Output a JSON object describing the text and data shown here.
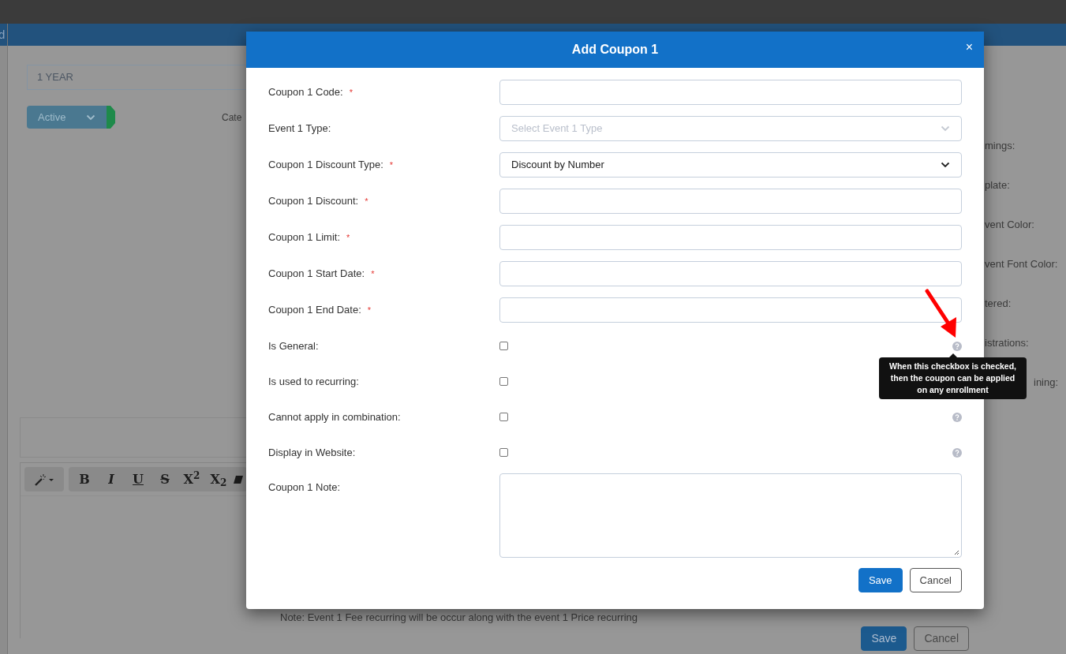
{
  "background": {
    "edge_text": "d",
    "duration_value": "1 YEAR",
    "status_select": "Active",
    "category_label": "Cate",
    "side_labels": [
      {
        "text": "mings:",
        "kind": "cut"
      },
      {
        "text": "plate:",
        "kind": "cut"
      },
      {
        "text": "vent Color:",
        "kind": "cut"
      },
      {
        "text": "vent Font Color:",
        "kind": "cut"
      },
      {
        "text": "tered:",
        "kind": "cut"
      },
      {
        "text": "istrations:",
        "kind": "cut"
      },
      {
        "text": "ining:",
        "kind": "covered"
      }
    ],
    "toolbar": [
      {
        "kind": "bold",
        "label": "B"
      },
      {
        "kind": "italic",
        "label": "I"
      },
      {
        "kind": "underline",
        "label": "U"
      },
      {
        "kind": "strike",
        "label": "S"
      },
      {
        "kind": "superscript",
        "label": "X$^{2}$"
      },
      {
        "kind": "subscript",
        "label": "X$_{2}$"
      }
    ],
    "note": "Note: Event 1 Fee recurring will be occur along with the event 1 Price recurring",
    "buttons": [
      {
        "kind": "primary",
        "label": "Save"
      },
      {
        "kind": "secondary",
        "label": "Cancel"
      }
    ]
  },
  "modal": {
    "title": "Add Coupon 1",
    "close": "×",
    "required_mark": "*",
    "fields": [
      {
        "kind": "text",
        "label": "Coupon 1 Code:",
        "required": true
      },
      {
        "kind": "select",
        "label": "Event 1 Type:",
        "required": false,
        "placeholder": "Select Event 1 Type"
      },
      {
        "kind": "select",
        "label": "Coupon 1 Discount Type:",
        "required": true,
        "value": "Discount by Number"
      },
      {
        "kind": "text",
        "label": "Coupon 1 Discount:",
        "required": true
      },
      {
        "kind": "text",
        "label": "Coupon 1 Limit:",
        "required": true
      },
      {
        "kind": "text",
        "label": "Coupon 1 Start Date:",
        "required": true
      },
      {
        "kind": "text",
        "label": "Coupon 1 End Date:",
        "required": true
      },
      {
        "kind": "checkbox",
        "label": "Is General:",
        "checked": false,
        "help": true,
        "tooltip": "When this checkbox is checked, then the coupon can be applied on any enrollment"
      },
      {
        "kind": "checkbox",
        "label": "Is used to recurring:",
        "checked": false
      },
      {
        "kind": "checkbox",
        "label": "Cannot apply in combination:",
        "checked": false,
        "help": true
      },
      {
        "kind": "checkbox",
        "label": "Display in Website:",
        "checked": false,
        "help": true
      },
      {
        "kind": "textarea",
        "label": "Coupon 1 Note:",
        "required": false
      }
    ],
    "buttons": [
      {
        "kind": "primary",
        "label": "Save"
      },
      {
        "kind": "secondary",
        "label": "Cancel"
      }
    ]
  }
}
